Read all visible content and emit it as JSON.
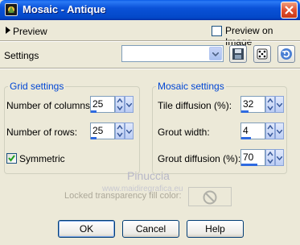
{
  "window": {
    "title": "Mosaic - Antique",
    "app_icon": "paint-shop-pro-icon",
    "close_icon": "close-icon"
  },
  "preview": {
    "label": "Preview",
    "preview_on_image_label": "Preview on Image",
    "preview_on_image_checked": false
  },
  "settings": {
    "label": "Settings",
    "preset_value": ""
  },
  "grid_settings": {
    "title": "Grid settings",
    "columns_label": "Number of columns:",
    "columns_value": "25",
    "columns_level": 0.25,
    "rows_label": "Number of rows:",
    "rows_value": "25",
    "rows_level": 0.25,
    "symmetric_label": "Symmetric",
    "symmetric_checked": true
  },
  "mosaic_settings": {
    "title": "Mosaic settings",
    "tile_diffusion_label": "Tile diffusion (%):",
    "tile_diffusion_value": "32",
    "tile_diffusion_level": 0.32,
    "grout_width_label": "Grout width:",
    "grout_width_value": "4",
    "grout_width_level": 0.4,
    "grout_diffusion_label": "Grout diffusion (%):",
    "grout_diffusion_value": "70",
    "grout_diffusion_level": 0.7
  },
  "locked": {
    "label": "Locked transparency fill color:"
  },
  "watermark": {
    "name": "Pinuccia",
    "url": "www.maidiregrafica.eu"
  },
  "buttons": {
    "ok": "OK",
    "cancel": "Cancel",
    "help": "Help"
  },
  "colors": {
    "accent": "#0046d5",
    "titlebar": "#0a52d8",
    "background": "#ece9d8",
    "spin_fill": "#2e6ae0"
  }
}
